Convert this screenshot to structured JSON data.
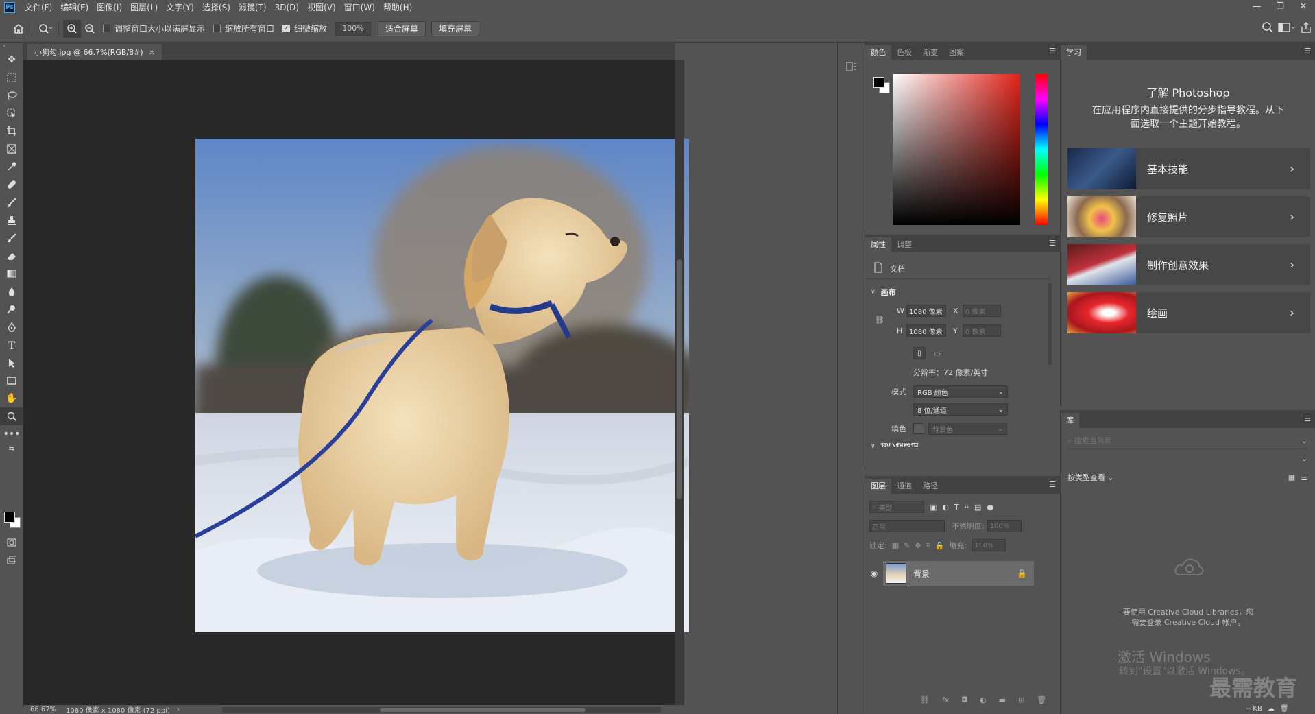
{
  "app": {
    "logo": "Ps"
  },
  "menu": [
    "文件(F)",
    "编辑(E)",
    "图像(I)",
    "图层(L)",
    "文字(Y)",
    "选择(S)",
    "滤镜(T)",
    "3D(D)",
    "视图(V)",
    "窗口(W)",
    "帮助(H)"
  ],
  "window_controls": [
    "—",
    "❐",
    "✕"
  ],
  "options": {
    "resize_windows": "调整窗口大小以满屏显示",
    "zoom_all": "缩放所有窗口",
    "scrubby_zoom": "细微缩放",
    "zoom_value": "100%",
    "fit_screen": "适合屏幕",
    "fill_screen": "填充屏幕"
  },
  "document": {
    "tab_title": "小狗勾.jpg @ 66.7%(RGB/8#)",
    "zoom_status": "66.67%",
    "size_status": "1080 像素 x 1080 像素 (72 ppi)"
  },
  "color_panel": {
    "tabs": [
      "颜色",
      "色板",
      "渐变",
      "图案"
    ],
    "fg": "#000000",
    "bg": "#ffffff",
    "hue": "#e2231a"
  },
  "properties": {
    "tabs": [
      "属性",
      "调整"
    ],
    "doc_label": "文档",
    "section_canvas": "画布",
    "w_label": "W",
    "w_value": "1080 像素",
    "h_label": "H",
    "h_value": "1080 像素",
    "x_label": "X",
    "x_value": "0 像素",
    "y_label": "Y",
    "y_value": "0 像素",
    "resolution": "分辨率：72 像素/英寸",
    "mode_label": "模式",
    "mode_value": "RGB 颜色",
    "depth_value": "8 位/通道",
    "fill_label": "填色",
    "fill_value": "背景色",
    "next_section": "标尺和网格"
  },
  "layers": {
    "tabs": [
      "图层",
      "通道",
      "路径"
    ],
    "filter_placeholder": "类型",
    "blend_mode": "正常",
    "opacity_label": "不透明度:",
    "opacity_value": "100%",
    "lock_label": "锁定:",
    "fill_label": "填充:",
    "fill_value": "100%",
    "layer_name": "背景"
  },
  "learn": {
    "tab": "学习",
    "title": "了解 Photoshop",
    "subtitle_line1": "在应用程序内直接提供的分步指导教程。从下",
    "subtitle_line2": "面选取一个主题开始教程。",
    "cards": [
      "基本技能",
      "修复照片",
      "制作创意效果",
      "绘画"
    ]
  },
  "library": {
    "tab": "库",
    "search_placeholder": "搜索当前库",
    "view_by": "按类型查看",
    "msg_line1": "要使用 Creative Cloud Libraries，您",
    "msg_line2": "需要登录 Creative Cloud 帐户。",
    "kb": "-- KB"
  },
  "watermark": {
    "line1": "激活 Windows",
    "line2": "转到\"设置\"以激活 Windows。",
    "brand": "最需教育"
  }
}
